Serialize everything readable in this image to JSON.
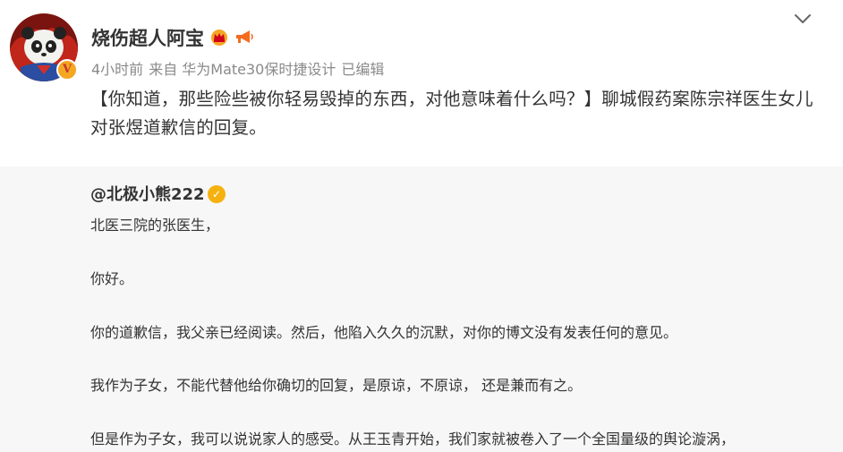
{
  "post": {
    "author": "烧伤超人阿宝",
    "time": "4小时前",
    "source": "来自 华为Mate30保时捷设计",
    "edited": "已编辑",
    "text": "【你知道，那些险些被你轻易毁掉的东西，对他意味着什么吗？】聊城假药案陈宗祥医生女儿对张煜道歉信的回复。",
    "badge_icons": [
      "crown-icon",
      "megaphone-icon"
    ],
    "avatar_icon": "panda-avatar",
    "verified_mark": "V"
  },
  "quote": {
    "author": "@北极小熊222",
    "verified_mark": "✓",
    "lines": [
      "北医三院的张医生，",
      "你好。",
      "你的道歉信，我父亲已经阅读。然后，他陷入久久的沉默，对你的博文没有发表任何的意见。",
      "我作为子女，不能代替他给你确切的回复，是原谅，不原谅， 还是兼而有之。",
      "但是作为子女，我可以说说家人的感受。从王玉青开始，我们家就被卷入了一个全国量级的舆论漩涡，"
    ]
  },
  "colors": {
    "text": "#333333",
    "meta": "#8a8a8a",
    "quote_bg": "#f7f7f7",
    "verified_gold": "#f5b20f"
  }
}
